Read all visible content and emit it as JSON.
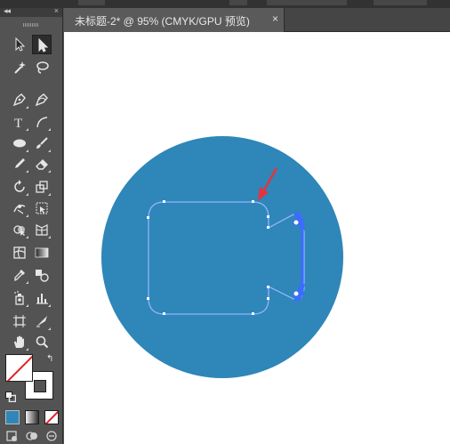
{
  "document": {
    "tab_title": "未标题-2* @ 95% (CMYK/GPU 预览)",
    "close_glyph": "×"
  },
  "panel": {
    "collapse_glyph": "◂◂",
    "close_glyph": "×",
    "swap_glyph": "↰"
  },
  "tools": [
    {
      "name": "selection-tool-icon"
    },
    {
      "name": "direct-selection-tool-icon",
      "active": true
    },
    {
      "name": "magic-wand-tool-icon"
    },
    {
      "name": "lasso-tool-icon"
    },
    {
      "name": "pen-tool-icon"
    },
    {
      "name": "curvature-tool-icon"
    },
    {
      "name": "type-tool-icon",
      "glyph": "T"
    },
    {
      "name": "line-segment-tool-icon"
    },
    {
      "name": "ellipse-tool-icon"
    },
    {
      "name": "paintbrush-tool-icon"
    },
    {
      "name": "pencil-tool-icon"
    },
    {
      "name": "eraser-tool-icon"
    },
    {
      "name": "rotate-tool-icon"
    },
    {
      "name": "scale-tool-icon"
    },
    {
      "name": "width-tool-icon"
    },
    {
      "name": "free-transform-tool-icon"
    },
    {
      "name": "shape-builder-tool-icon"
    },
    {
      "name": "perspective-grid-tool-icon"
    },
    {
      "name": "mesh-tool-icon"
    },
    {
      "name": "gradient-tool-icon"
    },
    {
      "name": "eyedropper-tool-icon"
    },
    {
      "name": "blend-tool-icon"
    },
    {
      "name": "symbol-sprayer-tool-icon"
    },
    {
      "name": "column-graph-tool-icon"
    },
    {
      "name": "artboard-tool-icon"
    },
    {
      "name": "slice-tool-icon"
    },
    {
      "name": "hand-tool-icon"
    },
    {
      "name": "zoom-tool-icon"
    }
  ],
  "colors": {
    "circle_fill": "#2f86b8",
    "path_stroke": "#8fb4ff",
    "anchor_blue": "#3d6bff",
    "arrow_red": "#e8323c",
    "stroke_none_red": "#e21f26",
    "ui_dark": "#535353"
  }
}
